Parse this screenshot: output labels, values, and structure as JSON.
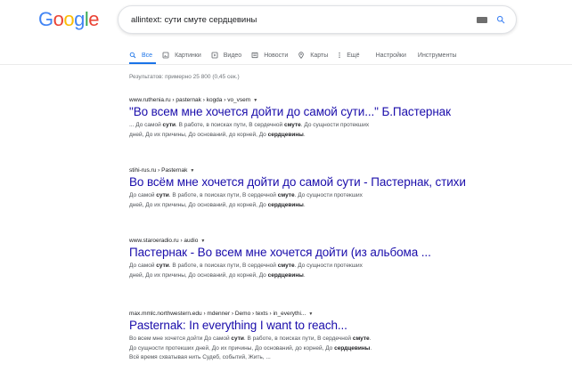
{
  "logo": {
    "letters": [
      "G",
      "o",
      "o",
      "g",
      "l",
      "e"
    ],
    "colors": [
      "#4285f4",
      "#ea4335",
      "#fbbc05",
      "#4285f4",
      "#34a853",
      "#ea4335"
    ]
  },
  "search": {
    "query": "allintext: сути смуте сердцевины"
  },
  "tabs": [
    {
      "label": "Все",
      "icon": "search-icon",
      "active": true
    },
    {
      "label": "Картинки",
      "icon": "image-icon"
    },
    {
      "label": "Видео",
      "icon": "video-icon"
    },
    {
      "label": "Новости",
      "icon": "news-icon"
    },
    {
      "label": "Карты",
      "icon": "map-pin-icon"
    },
    {
      "label": "Ещё",
      "icon": "more-vert-icon"
    },
    {
      "label": "Настройки"
    },
    {
      "label": "Инструменты"
    }
  ],
  "stats": "Результатов: примерно 25 800 (0,45 сек.)",
  "results": [
    {
      "url": "www.ruthenia.ru › pasternak › kogda › vo_vsem",
      "title": "\"Во всем мне хочется дойти до самой сути...\" Б.Пастернак",
      "snippet": [
        [
          {
            "t": "... До самой "
          },
          {
            "t": "сути",
            "b": true
          },
          {
            "t": ". В работе, в поисках пути, В сердечной "
          },
          {
            "t": "смуте",
            "b": true
          },
          {
            "t": ". До сущности протекших"
          }
        ],
        [
          {
            "t": "дней, До их причины, До оснований, до корней, До "
          },
          {
            "t": "сердцевины",
            "b": true
          },
          {
            "t": "."
          }
        ]
      ]
    },
    {
      "url": "stihi-rus.ru › Pasternak",
      "title": "Во всём мне хочется дойти до самой сути - Пастернак, стихи",
      "snippet": [
        [
          {
            "t": "До самой "
          },
          {
            "t": "сути",
            "b": true
          },
          {
            "t": ". В работе, в поисках пути, В сердечной "
          },
          {
            "t": "смуте",
            "b": true
          },
          {
            "t": ". До сущности протекших"
          }
        ],
        [
          {
            "t": "дней, До их причины, До оснований, до корней, До "
          },
          {
            "t": "сердцевины",
            "b": true
          },
          {
            "t": "."
          }
        ]
      ]
    },
    {
      "url": "www.staroeradio.ru › audio",
      "title": "Пастернак - Во всем мне хочется дойти (из альбома ...",
      "snippet": [
        [
          {
            "t": "До самой "
          },
          {
            "t": "сути",
            "b": true
          },
          {
            "t": ". В работе, в поисках пути, В сердечной "
          },
          {
            "t": "смуте",
            "b": true
          },
          {
            "t": ". До сущности протекших"
          }
        ],
        [
          {
            "t": "дней, До их причины, До оснований, до корней, До "
          },
          {
            "t": "сердцевины",
            "b": true
          },
          {
            "t": "."
          }
        ]
      ]
    },
    {
      "url": "max.mmlc.northwestern.edu › mdenner › Demo › texts › in_everythi...",
      "title": "Pasternak: In everything I want to reach...",
      "snippet": [
        [
          {
            "t": "Во всем мне хочется дойти До самой "
          },
          {
            "t": "сути",
            "b": true
          },
          {
            "t": ". В работе, в поисках пути, В сердечной "
          },
          {
            "t": "смуте",
            "b": true
          },
          {
            "t": "."
          }
        ],
        [
          {
            "t": "До сущности протекших дней, До их причины, До оснований, до корней, До "
          },
          {
            "t": "сердцевины",
            "b": true
          },
          {
            "t": "."
          }
        ],
        [
          {
            "t": "Всё время схватывая нить Судеб, событий, Жить, ..."
          }
        ]
      ]
    }
  ]
}
